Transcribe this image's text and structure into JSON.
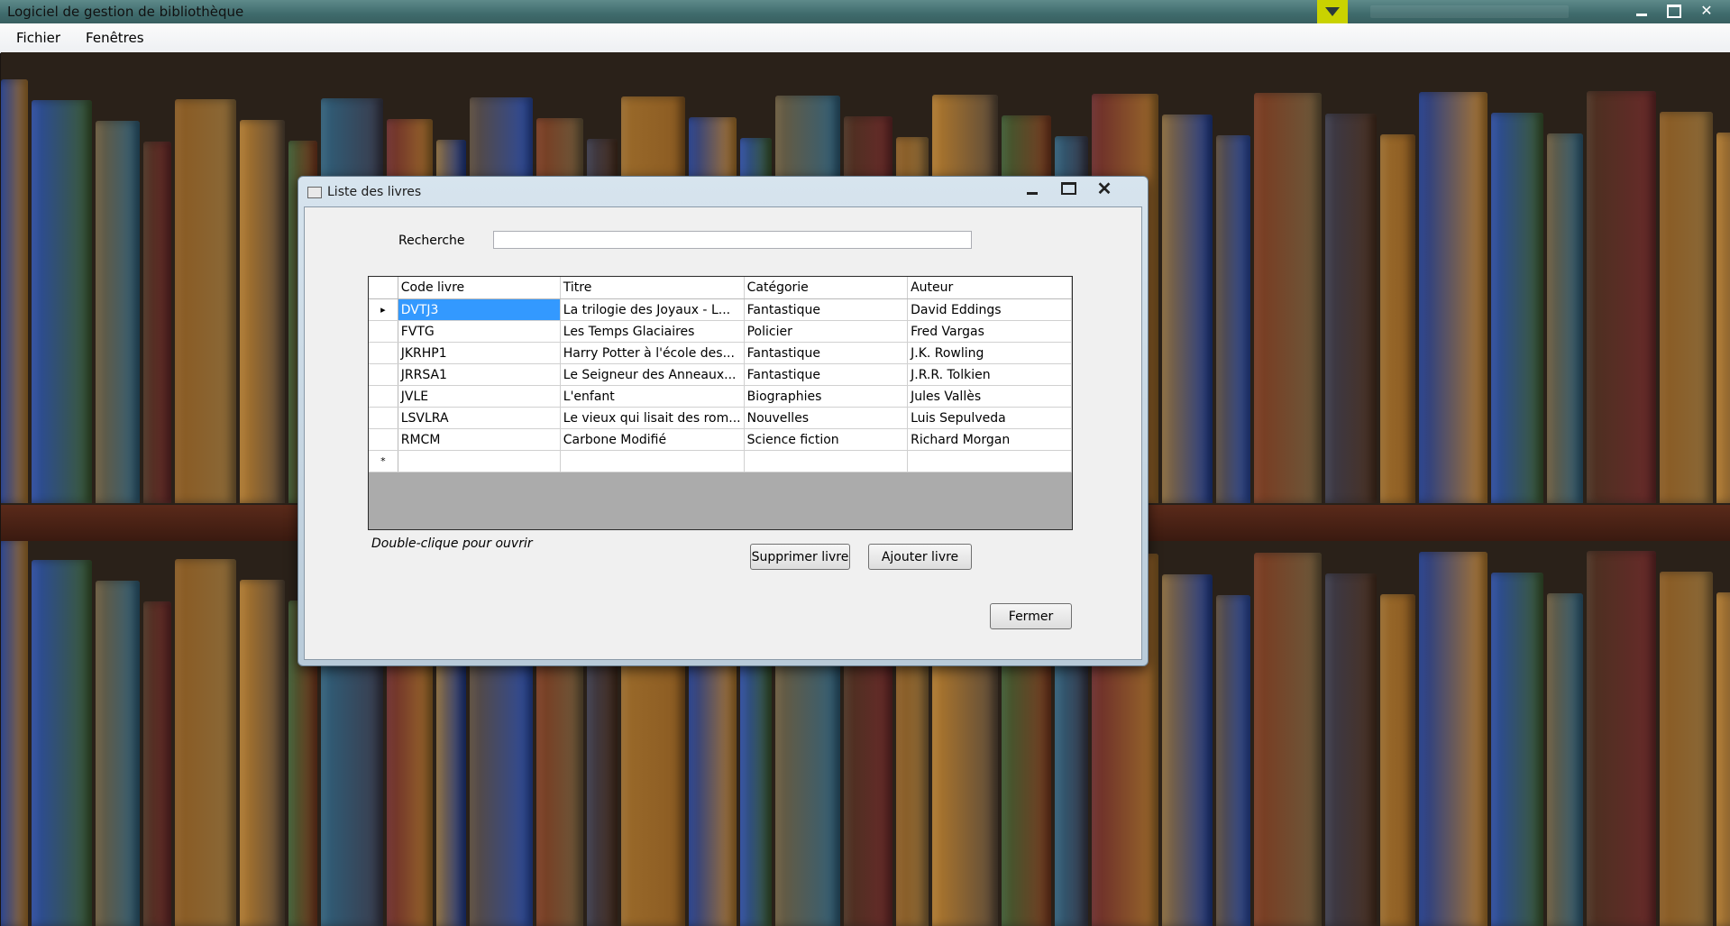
{
  "app": {
    "title": "Logiciel de gestion de bibliothèque"
  },
  "menu": {
    "items": [
      "Fichier",
      "Fenêtres"
    ]
  },
  "dialog": {
    "title": "Liste des livres",
    "search_label": "Recherche",
    "search_value": "",
    "hint": "Double-clique pour ouvrir",
    "delete_button": "Supprimer livre",
    "add_button": "Ajouter livre",
    "close_button": "Fermer"
  },
  "grid": {
    "columns": [
      "Code livre",
      "Titre",
      "Catégorie",
      "Auteur"
    ],
    "rows": [
      [
        "DVTJ3",
        "La trilogie des Joyaux - L...",
        "Fantastique",
        "David Eddings"
      ],
      [
        "FVTG",
        "Les Temps Glaciaires",
        "Policier",
        "Fred Vargas"
      ],
      [
        "JKRHP1",
        "Harry Potter à l'école des...",
        "Fantastique",
        "J.K. Rowling"
      ],
      [
        "JRRSA1",
        "Le Seigneur des Anneaux...",
        "Fantastique",
        "J.R.R. Tolkien"
      ],
      [
        "JVLE",
        "L'enfant",
        "Biographies",
        "Jules Vallès"
      ],
      [
        "LSVLRA",
        "Le vieux qui lisait des rom...",
        "Nouvelles",
        "Luis Sepulveda"
      ],
      [
        "RMCM",
        "Carbone Modifié",
        "Science fiction",
        "Richard Morgan"
      ]
    ],
    "current_row_marker": "▸",
    "new_row_marker": "*"
  },
  "colors": {
    "titlebar": "#3f6b6c",
    "selection": "#3399ff",
    "pin": "#c9d200"
  }
}
